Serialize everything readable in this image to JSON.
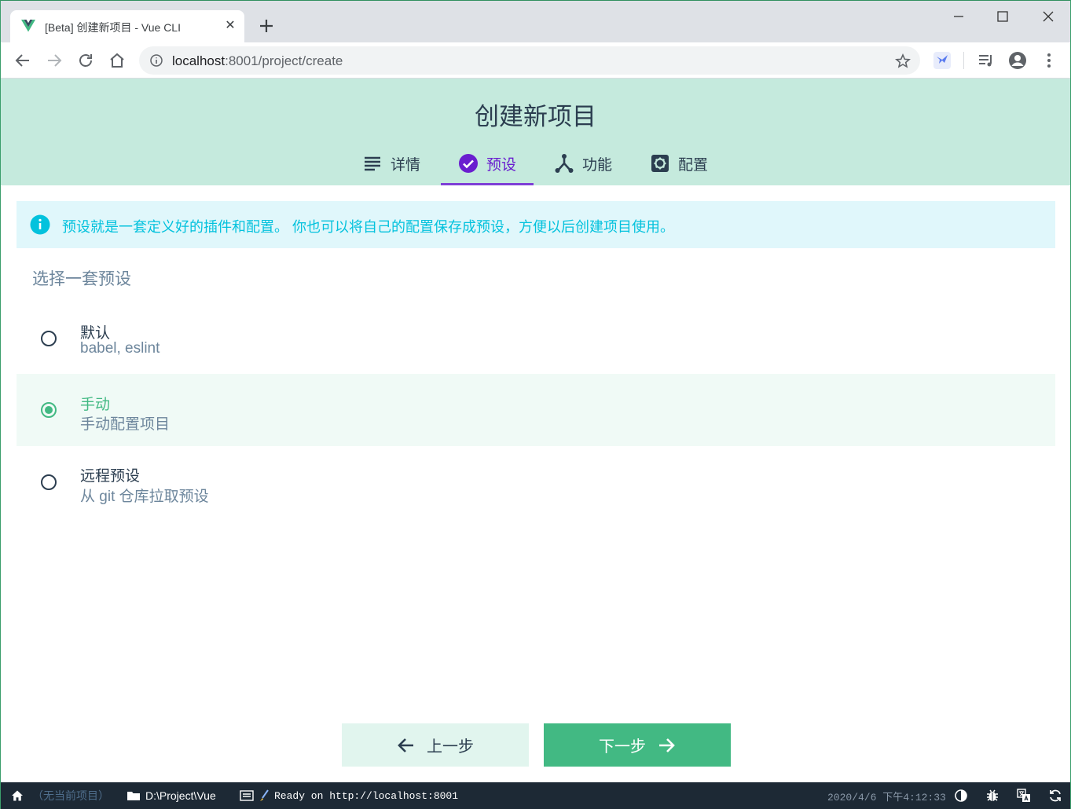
{
  "browser": {
    "tab_title": "[Beta] 创建新项目 - Vue CLI",
    "url_host": "localhost",
    "url_path": ":8001/project/create"
  },
  "header": {
    "title": "创建新项目",
    "steps": [
      {
        "label": "详情",
        "icon": "list-icon",
        "active": false
      },
      {
        "label": "预设",
        "icon": "check-circle-icon",
        "active": true
      },
      {
        "label": "功能",
        "icon": "fork-icon",
        "active": false
      },
      {
        "label": "配置",
        "icon": "settings-icon",
        "active": false
      }
    ]
  },
  "info": {
    "text": "预设就是一套定义好的插件和配置。 你也可以将自己的配置保存成预设，方便以后创建项目使用。"
  },
  "presets": {
    "section_title": "选择一套预设",
    "options": [
      {
        "name": "默认",
        "description": "babel, eslint",
        "selected": false
      },
      {
        "name": "手动",
        "description": "手动配置项目",
        "selected": true
      },
      {
        "name": "远程预设",
        "description": "从 git 仓库拉取预设",
        "selected": false
      }
    ]
  },
  "actions": {
    "prev_label": "上一步",
    "next_label": "下一步"
  },
  "statusbar": {
    "no_project": "（无当前项目）",
    "path": "D:\\Project\\Vue",
    "log": "Ready on http://localhost:8001",
    "datetime": "2020/4/6 下午4:12:33"
  },
  "colors": {
    "accent": "#42b983",
    "header_bg": "#c5eadd",
    "active_step": "#6a1ecf",
    "info": "#03c2dd",
    "statusbar_bg": "#1d2935"
  }
}
